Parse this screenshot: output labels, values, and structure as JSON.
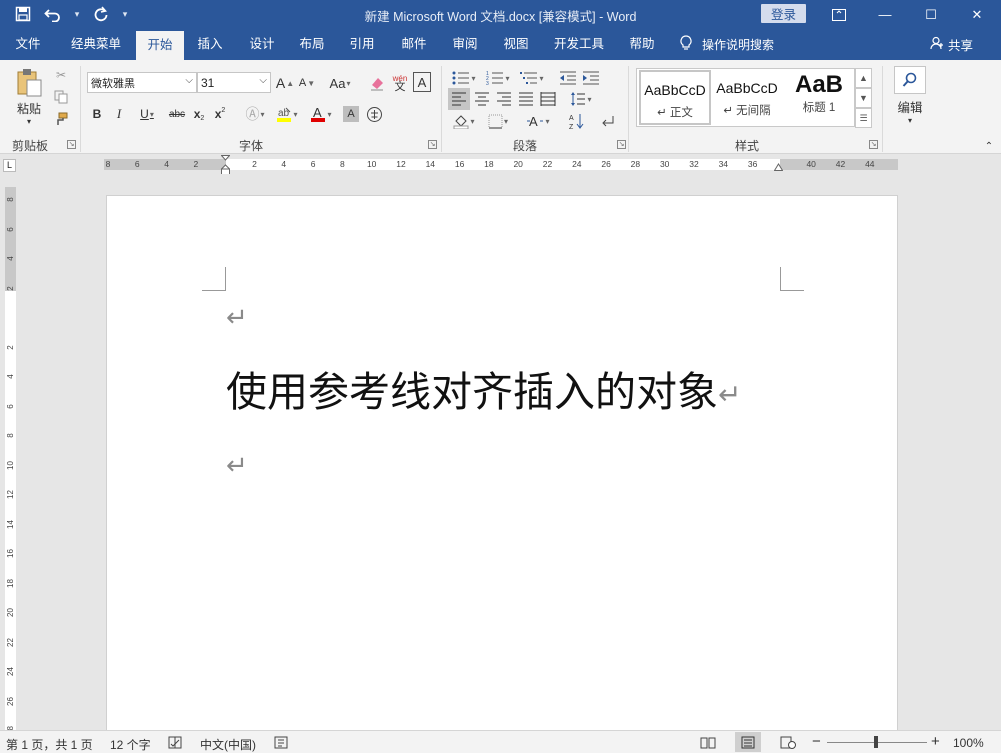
{
  "window": {
    "title": "新建 Microsoft Word 文档.docx [兼容模式]  -  Word",
    "login": "登录",
    "controls": {
      "minimize": "—",
      "restore": "☐",
      "close": "✕"
    }
  },
  "qat": {
    "save_icon": "save-icon",
    "undo_icon": "undo-icon",
    "redo_icon": "redo-icon",
    "customize": "▾"
  },
  "tabs": [
    {
      "label": "文件"
    },
    {
      "label": "经典菜单"
    },
    {
      "label": "开始"
    },
    {
      "label": "插入"
    },
    {
      "label": "设计"
    },
    {
      "label": "布局"
    },
    {
      "label": "引用"
    },
    {
      "label": "邮件"
    },
    {
      "label": "审阅"
    },
    {
      "label": "视图"
    },
    {
      "label": "开发工具"
    },
    {
      "label": "帮助"
    }
  ],
  "active_tab": "开始",
  "tell_me": "操作说明搜索",
  "share": "共享",
  "ribbon": {
    "clipboard": {
      "label": "剪贴板",
      "paste": "粘贴"
    },
    "font": {
      "label": "字体",
      "font_name": "微软雅黑",
      "font_size": "31",
      "grow": "A",
      "shrink": "A",
      "case": "Aa",
      "bold": "B",
      "italic": "I",
      "underline": "U",
      "strike": "abc",
      "sub": "x",
      "sup": "x",
      "phonetic": "wén",
      "phonetic_char": "文"
    },
    "paragraph": {
      "label": "段落"
    },
    "styles": {
      "label": "样式",
      "items": [
        {
          "sample": "AaBbCcD",
          "name": "↵ 正文"
        },
        {
          "sample": "AaBbCcD",
          "name": "↵ 无间隔"
        },
        {
          "sample": "AaB",
          "name": "标题 1"
        }
      ]
    },
    "editing": {
      "label": "编辑"
    }
  },
  "ruler": {
    "corner": "L",
    "ticks": [
      "8",
      "6",
      "4",
      "2",
      "",
      "2",
      "4",
      "6",
      "8",
      "10",
      "12",
      "14",
      "16",
      "18",
      "20",
      "22",
      "24",
      "26",
      "28",
      "30",
      "32",
      "34",
      "36",
      "",
      "40",
      "42",
      "44"
    ],
    "vticks": [
      "8",
      "6",
      "4",
      "2",
      "",
      "2",
      "4",
      "6",
      "8",
      "10",
      "12",
      "14",
      "16",
      "18",
      "20",
      "22",
      "24",
      "26",
      "28"
    ]
  },
  "document": {
    "heading": "使用参考线对齐插入的对象",
    "paragraph_mark": "↵"
  },
  "status": {
    "page": "第 1 页，共 1 页",
    "words": "12 个字",
    "language": "中文(中国)",
    "zoom": "100%",
    "zoom_minus": "−",
    "zoom_plus": "+"
  }
}
